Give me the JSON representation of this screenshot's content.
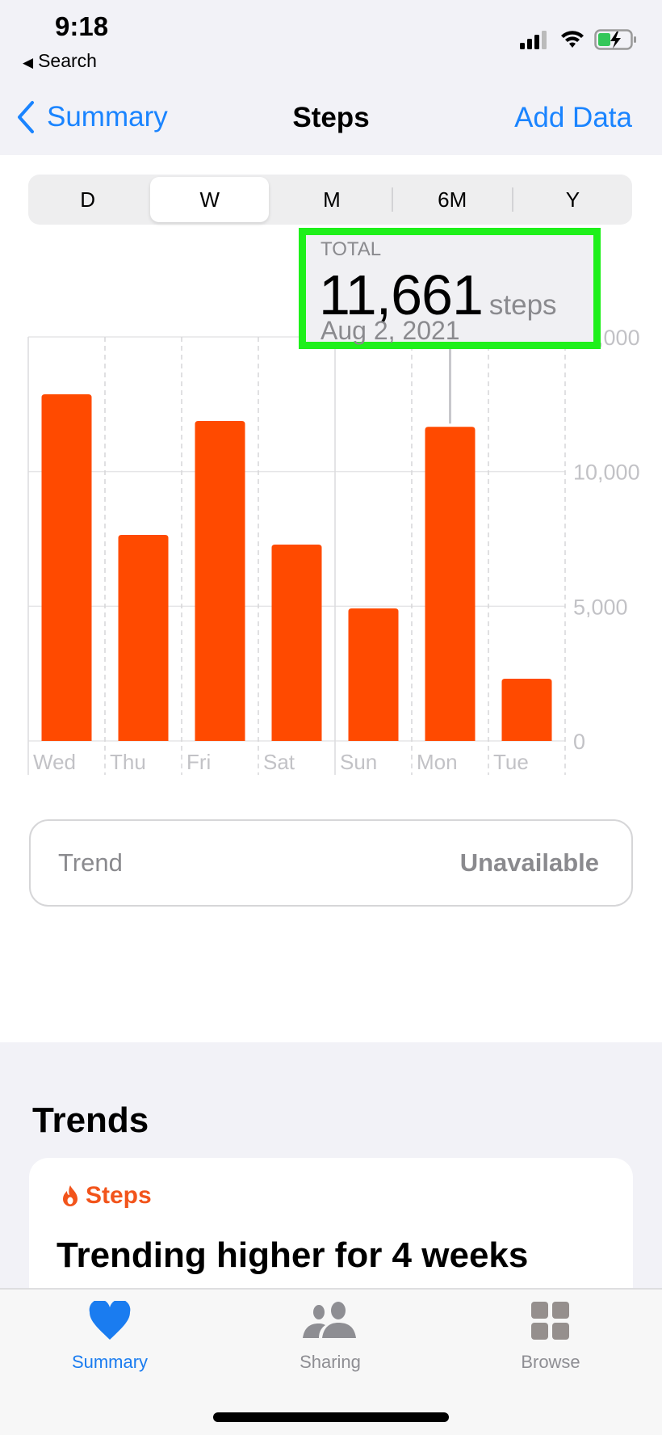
{
  "status_bar": {
    "time": "9:18",
    "back_app": "Search",
    "back_icon": "back-triangle",
    "icons": [
      "cellular-signal-icon",
      "wifi-icon",
      "battery-charging-icon"
    ]
  },
  "nav": {
    "back_label": "Summary",
    "title": "Steps",
    "action_label": "Add Data"
  },
  "segments": [
    {
      "label": "D",
      "active": false
    },
    {
      "label": "W",
      "active": true
    },
    {
      "label": "M",
      "active": false
    },
    {
      "label": "6M",
      "active": false
    },
    {
      "label": "Y",
      "active": false
    }
  ],
  "selection": {
    "label": "TOTAL",
    "value": "11,661",
    "unit": "steps",
    "date": "Aug 2, 2021"
  },
  "chart_data": {
    "type": "bar",
    "title": "",
    "xlabel": "",
    "ylabel": "steps",
    "categories": [
      "Wed",
      "Thu",
      "Fri",
      "Sat",
      "Sun",
      "Mon",
      "Tue"
    ],
    "values": [
      12870,
      7650,
      11880,
      7290,
      4920,
      11661,
      2310
    ],
    "selected_index": 5,
    "ylim": [
      0,
      15000
    ],
    "yticks": [
      0,
      5000,
      10000,
      15000
    ],
    "ytick_labels": [
      "0",
      "5,000",
      "10,000",
      "15,000"
    ],
    "y_axis_side": "right",
    "grid": true,
    "bar_color": "#ff4a00"
  },
  "trend": {
    "label": "Trend",
    "value": "Unavailable"
  },
  "trends_section": {
    "title": "Trends",
    "card": {
      "category": "Steps",
      "category_icon": "flame-icon",
      "category_color": "#f2541b",
      "headline": "Trending higher for 4 weeks"
    }
  },
  "tabbar": {
    "tabs": [
      {
        "label": "Summary",
        "icon": "heart-icon",
        "active": true
      },
      {
        "label": "Sharing",
        "icon": "people-icon",
        "active": false
      },
      {
        "label": "Browse",
        "icon": "grid-icon",
        "active": false
      }
    ],
    "active_color": "#1a7cf0",
    "inactive_color": "#8e8e93"
  }
}
